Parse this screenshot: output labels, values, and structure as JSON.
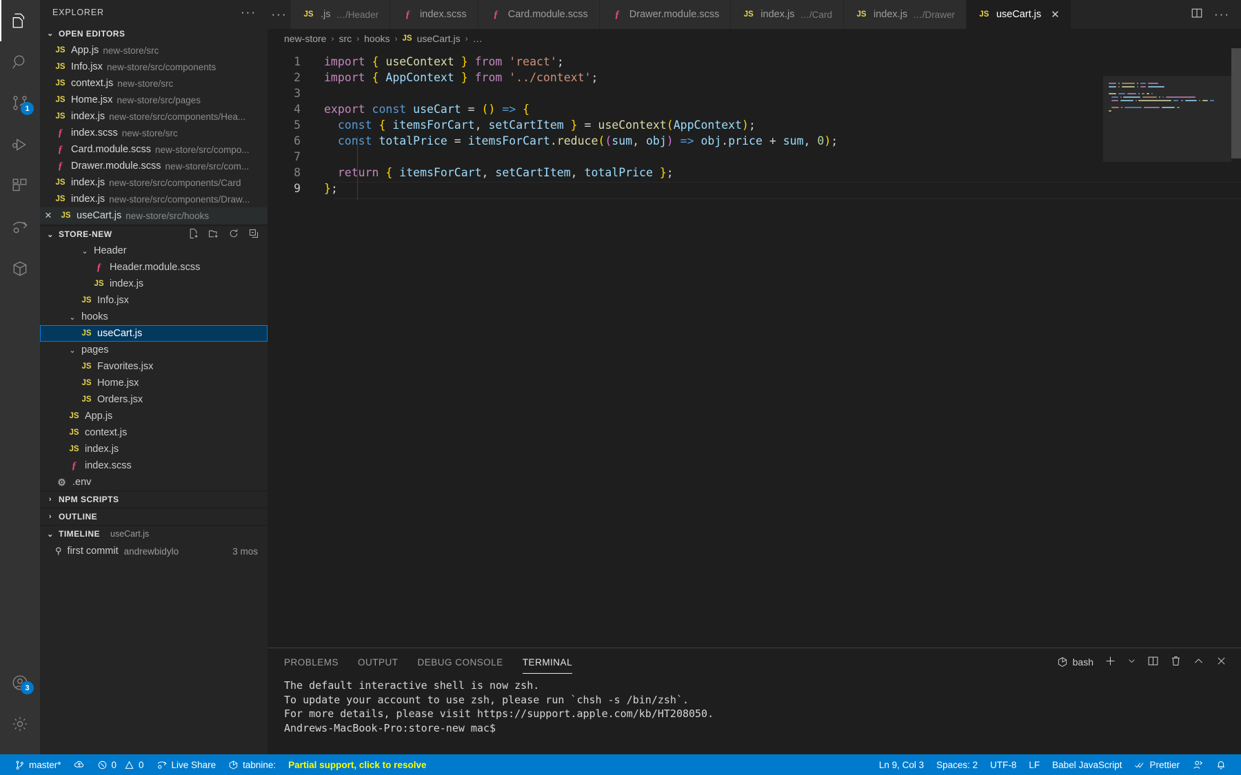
{
  "activitybar": {
    "items": [
      {
        "name": "explorer-icon",
        "label": "Explorer",
        "active": true,
        "badge": null
      },
      {
        "name": "search-icon",
        "label": "Search",
        "active": false,
        "badge": null
      },
      {
        "name": "source-control-icon",
        "label": "Source Control",
        "active": false,
        "badge": "1"
      },
      {
        "name": "run-and-debug-icon",
        "label": "Run and Debug",
        "active": false,
        "badge": null
      },
      {
        "name": "extensions-icon",
        "label": "Extensions",
        "active": false,
        "badge": null
      },
      {
        "name": "live-share-icon",
        "label": "Live Share",
        "active": false,
        "badge": null
      },
      {
        "name": "remote-explorer-icon",
        "label": "Remote Explorer",
        "active": false,
        "badge": null
      }
    ],
    "bottom": [
      {
        "name": "accounts-icon",
        "label": "Accounts",
        "badge": "3"
      },
      {
        "name": "manage-gear-icon",
        "label": "Manage",
        "badge": null
      }
    ]
  },
  "sidebar": {
    "title": "EXPLORER",
    "more_label": "···",
    "open_editors": {
      "label": "OPEN EDITORS",
      "chevron": "⌄",
      "items": [
        {
          "icon": "js",
          "name": "App.js",
          "path": "new-store/src",
          "dirty": false
        },
        {
          "icon": "js",
          "name": "Info.jsx",
          "path": "new-store/src/components",
          "dirty": false
        },
        {
          "icon": "js",
          "name": "context.js",
          "path": "new-store/src",
          "dirty": false
        },
        {
          "icon": "js",
          "name": "Home.jsx",
          "path": "new-store/src/pages",
          "dirty": false
        },
        {
          "icon": "js",
          "name": "index.js",
          "path": "new-store/src/components/Hea...",
          "dirty": false
        },
        {
          "icon": "scss",
          "name": "index.scss",
          "path": "new-store/src",
          "dirty": false
        },
        {
          "icon": "scss",
          "name": "Card.module.scss",
          "path": "new-store/src/compo...",
          "dirty": false
        },
        {
          "icon": "scss",
          "name": "Drawer.module.scss",
          "path": "new-store/src/com...",
          "dirty": false
        },
        {
          "icon": "js",
          "name": "index.js",
          "path": "new-store/src/components/Card",
          "dirty": false
        },
        {
          "icon": "js",
          "name": "index.js",
          "path": "new-store/src/components/Draw...",
          "dirty": false
        },
        {
          "icon": "js",
          "name": "useCart.js",
          "path": "new-store/src/hooks",
          "dirty": true,
          "close": "✕"
        }
      ]
    },
    "project": {
      "label": "STORE-NEW",
      "chevron": "⌄",
      "actions": [
        "new-file-icon",
        "new-folder-icon",
        "refresh-icon",
        "collapse-all-icon"
      ],
      "tree": [
        {
          "kind": "folder",
          "name": "Header",
          "depth": 1,
          "chevron": "⌄"
        },
        {
          "kind": "file",
          "icon": "scss",
          "name": "Header.module.scss",
          "depth": 2
        },
        {
          "kind": "file",
          "icon": "js",
          "name": "index.js",
          "depth": 2
        },
        {
          "kind": "file",
          "icon": "js",
          "name": "Info.jsx",
          "depth": 1
        },
        {
          "kind": "folder",
          "name": "hooks",
          "depth": 0,
          "chevron": "⌄"
        },
        {
          "kind": "file",
          "icon": "js",
          "name": "useCart.js",
          "depth": 1,
          "selected": true
        },
        {
          "kind": "folder",
          "name": "pages",
          "depth": 0,
          "chevron": "⌄"
        },
        {
          "kind": "file",
          "icon": "js",
          "name": "Favorites.jsx",
          "depth": 1
        },
        {
          "kind": "file",
          "icon": "js",
          "name": "Home.jsx",
          "depth": 1
        },
        {
          "kind": "file",
          "icon": "js",
          "name": "Orders.jsx",
          "depth": 1
        },
        {
          "kind": "file",
          "icon": "js",
          "name": "App.js",
          "depth": 0
        },
        {
          "kind": "file",
          "icon": "js",
          "name": "context.js",
          "depth": 0
        },
        {
          "kind": "file",
          "icon": "js",
          "name": "index.js",
          "depth": 0
        },
        {
          "kind": "file",
          "icon": "scss",
          "name": "index.scss",
          "depth": 0
        },
        {
          "kind": "file",
          "icon": "env",
          "name": ".env",
          "depth": -1
        }
      ]
    },
    "npm_scripts": {
      "label": "NPM SCRIPTS",
      "chevron": "›"
    },
    "outline": {
      "label": "OUTLINE",
      "chevron": "›"
    },
    "timeline": {
      "label": "TIMELINE",
      "chevron": "⌄",
      "subject": "useCart.js",
      "entries": [
        {
          "message": "first commit",
          "author": "andrewbidylo",
          "when": "3 mos"
        }
      ]
    }
  },
  "tabs": {
    "overflow": "···",
    "items": [
      {
        "icon": "js",
        "name": ".js",
        "path": "…/Header",
        "active": false,
        "truncated": true
      },
      {
        "icon": "scss",
        "name": "index.scss",
        "path": "",
        "active": false
      },
      {
        "icon": "scss",
        "name": "Card.module.scss",
        "path": "",
        "active": false
      },
      {
        "icon": "scss",
        "name": "Drawer.module.scss",
        "path": "",
        "active": false
      },
      {
        "icon": "js",
        "name": "index.js",
        "path": "…/Card",
        "active": false
      },
      {
        "icon": "js",
        "name": "index.js",
        "path": "…/Drawer",
        "active": false
      },
      {
        "icon": "js",
        "name": "useCart.js",
        "path": "",
        "active": true,
        "close": "✕"
      }
    ],
    "actions": [
      "split-editor-icon",
      "more-actions-icon"
    ]
  },
  "breadcrumb": {
    "sep": "›",
    "parts": [
      "new-store",
      "src",
      "hooks"
    ],
    "file": "useCart.js",
    "file_icon": "JS",
    "tail": "…"
  },
  "editor": {
    "language": "javascript",
    "lines": [
      {
        "n": "1",
        "text": "import { useContext } from 'react';"
      },
      {
        "n": "2",
        "text": "import { AppContext } from '../context';"
      },
      {
        "n": "3",
        "text": ""
      },
      {
        "n": "4",
        "text": "export const useCart = () => {"
      },
      {
        "n": "5",
        "text": "  const { itemsForCart, setCartItem } = useContext(AppContext);"
      },
      {
        "n": "6",
        "text": "  const totalPrice = itemsForCart.reduce((sum, obj) => obj.price + sum, 0);"
      },
      {
        "n": "7",
        "text": ""
      },
      {
        "n": "8",
        "text": "  return { itemsForCart, setCartItem, totalPrice };"
      },
      {
        "n": "9",
        "text": "};",
        "current": true
      }
    ]
  },
  "panel": {
    "tabs": [
      {
        "label": "PROBLEMS",
        "active": false
      },
      {
        "label": "OUTPUT",
        "active": false
      },
      {
        "label": "DEBUG CONSOLE",
        "active": false
      },
      {
        "label": "TERMINAL",
        "active": true
      }
    ],
    "shell_label": "bash",
    "actions": [
      "new-terminal-icon",
      "terminal-dropdown-icon",
      "split-terminal-icon",
      "kill-terminal-icon",
      "maximize-panel-icon",
      "close-panel-icon"
    ],
    "terminal_output": "The default interactive shell is now zsh.\nTo update your account to use zsh, please run `chsh -s /bin/zsh`.\nFor more details, please visit https://support.apple.com/kb/HT208050.\nAndrews-MacBook-Pro:store-new mac$ "
  },
  "statusbar": {
    "left": [
      {
        "name": "branch",
        "icon": "branch-icon",
        "label": "master*"
      },
      {
        "name": "sync",
        "icon": "sync-cloud-icon",
        "label": ""
      },
      {
        "name": "problems",
        "icon": "error-warning-icon",
        "label": "0  0",
        "errors": "0",
        "warnings": "0"
      },
      {
        "name": "live-share",
        "icon": "live-share-icon",
        "label": "Live Share"
      },
      {
        "name": "tabnine",
        "icon": "tabnine-icon",
        "label": "tabnine:"
      },
      {
        "name": "tabnine-status",
        "icon": "",
        "label": "Partial support, click to resolve",
        "warn": true
      }
    ],
    "right": [
      {
        "name": "cursor-position",
        "label": "Ln 9, Col 3"
      },
      {
        "name": "indentation",
        "label": "Spaces: 2"
      },
      {
        "name": "encoding",
        "label": "UTF-8"
      },
      {
        "name": "eol",
        "label": "LF"
      },
      {
        "name": "language-mode",
        "label": "Babel JavaScript"
      },
      {
        "name": "prettier",
        "icon": "check-check-icon",
        "label": "Prettier"
      },
      {
        "name": "feedback",
        "icon": "feedback-icon",
        "label": ""
      },
      {
        "name": "notifications",
        "icon": "bell-icon",
        "label": ""
      }
    ]
  },
  "colors": {
    "accent": "#007acc",
    "selection": "#04395e",
    "selection_border": "#0c7cd5",
    "warning_text": "#ffff00",
    "js_icon": "#e8d44d",
    "scss_icon": "#e5497f"
  }
}
